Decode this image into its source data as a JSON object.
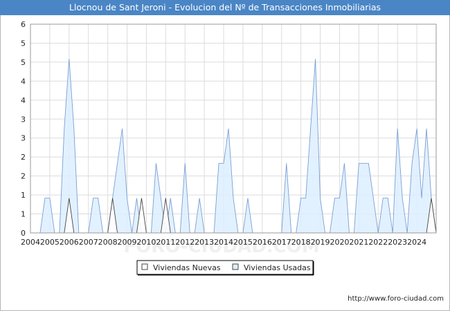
{
  "chart_data": {
    "type": "area",
    "title": "Llocnou de Sant Jeroni - Evolucion del Nº de Transacciones Inmobiliarias",
    "xlabel": "",
    "ylabel": "",
    "ylim": [
      0,
      6
    ],
    "y_ticks": [
      "0",
      "1",
      "1",
      "2",
      "2",
      "3",
      "3",
      "4",
      "4",
      "5",
      "5",
      "6"
    ],
    "x_tick_labels": [
      "2004",
      "2005",
      "2006",
      "2007",
      "2008",
      "2009",
      "2010",
      "2011",
      "2012",
      "2013",
      "2014",
      "2015",
      "2016",
      "2017",
      "2018",
      "2019",
      "2020",
      "2021",
      "2022",
      "2023",
      "2024"
    ],
    "grid": true,
    "legend_position": "bottom-center",
    "series": [
      {
        "name": "Viviendas Nuevas",
        "color": "#ffffff",
        "stroke": "#444444",
        "points": [
          [
            2005.75,
            0
          ],
          [
            2006.0,
            1
          ],
          [
            2006.25,
            0
          ],
          [
            2008.0,
            0
          ],
          [
            2008.25,
            1
          ],
          [
            2008.5,
            0
          ],
          [
            2009.5,
            0
          ],
          [
            2009.75,
            1
          ],
          [
            2010.0,
            0
          ],
          [
            2010.75,
            0
          ],
          [
            2011.0,
            1
          ],
          [
            2011.25,
            0
          ],
          [
            2024.5,
            0
          ],
          [
            2024.75,
            1
          ],
          [
            2025.0,
            0
          ]
        ]
      },
      {
        "name": "Viviendas Usadas",
        "color": "#ddeeff",
        "stroke": "#7a9fd4",
        "points": [
          [
            2004.0,
            0
          ],
          [
            2004.5,
            0
          ],
          [
            2004.75,
            1
          ],
          [
            2005.0,
            1
          ],
          [
            2005.25,
            0
          ],
          [
            2005.5,
            0
          ],
          [
            2005.75,
            3
          ],
          [
            2006.0,
            5
          ],
          [
            2006.25,
            3
          ],
          [
            2006.5,
            0
          ],
          [
            2007.0,
            0
          ],
          [
            2007.25,
            1
          ],
          [
            2007.5,
            1
          ],
          [
            2007.75,
            0
          ],
          [
            2008.0,
            0
          ],
          [
            2008.25,
            1
          ],
          [
            2008.5,
            2
          ],
          [
            2008.75,
            3
          ],
          [
            2009.0,
            1
          ],
          [
            2009.25,
            0
          ],
          [
            2009.5,
            1
          ],
          [
            2009.75,
            0
          ],
          [
            2010.25,
            0
          ],
          [
            2010.5,
            2
          ],
          [
            2010.75,
            1
          ],
          [
            2011.0,
            0
          ],
          [
            2011.25,
            1
          ],
          [
            2011.5,
            0
          ],
          [
            2011.75,
            0
          ],
          [
            2012.0,
            2
          ],
          [
            2012.25,
            0
          ],
          [
            2012.5,
            0
          ],
          [
            2012.75,
            1
          ],
          [
            2013.0,
            0
          ],
          [
            2013.5,
            0
          ],
          [
            2013.75,
            2
          ],
          [
            2014.0,
            2
          ],
          [
            2014.25,
            3
          ],
          [
            2014.5,
            1
          ],
          [
            2014.75,
            0
          ],
          [
            2015.0,
            0
          ],
          [
            2015.25,
            1
          ],
          [
            2015.5,
            0
          ],
          [
            2016.5,
            0
          ],
          [
            2017.0,
            0
          ],
          [
            2017.25,
            2
          ],
          [
            2017.5,
            0
          ],
          [
            2017.75,
            0
          ],
          [
            2018.0,
            1
          ],
          [
            2018.25,
            1
          ],
          [
            2018.5,
            3
          ],
          [
            2018.75,
            5
          ],
          [
            2019.0,
            1
          ],
          [
            2019.25,
            0
          ],
          [
            2019.5,
            0
          ],
          [
            2019.75,
            1
          ],
          [
            2020.0,
            1
          ],
          [
            2020.25,
            2
          ],
          [
            2020.5,
            0
          ],
          [
            2020.75,
            0
          ],
          [
            2021.0,
            2
          ],
          [
            2021.25,
            2
          ],
          [
            2021.5,
            2
          ],
          [
            2021.75,
            1
          ],
          [
            2022.0,
            0
          ],
          [
            2022.25,
            1
          ],
          [
            2022.5,
            1
          ],
          [
            2022.75,
            0
          ],
          [
            2023.0,
            3
          ],
          [
            2023.25,
            1
          ],
          [
            2023.5,
            0
          ],
          [
            2023.75,
            2
          ],
          [
            2024.0,
            3
          ],
          [
            2024.25,
            1
          ],
          [
            2024.5,
            3
          ],
          [
            2024.75,
            1
          ],
          [
            2025.0,
            0
          ]
        ]
      }
    ]
  },
  "legend": {
    "items": [
      {
        "label": "Viviendas Nuevas",
        "color": "#ffffff"
      },
      {
        "label": "Viviendas Usadas",
        "color": "#ddeeff"
      }
    ]
  },
  "watermark": "FORO-CIUDAD.COM",
  "source": "http://www.foro-ciudad.com"
}
